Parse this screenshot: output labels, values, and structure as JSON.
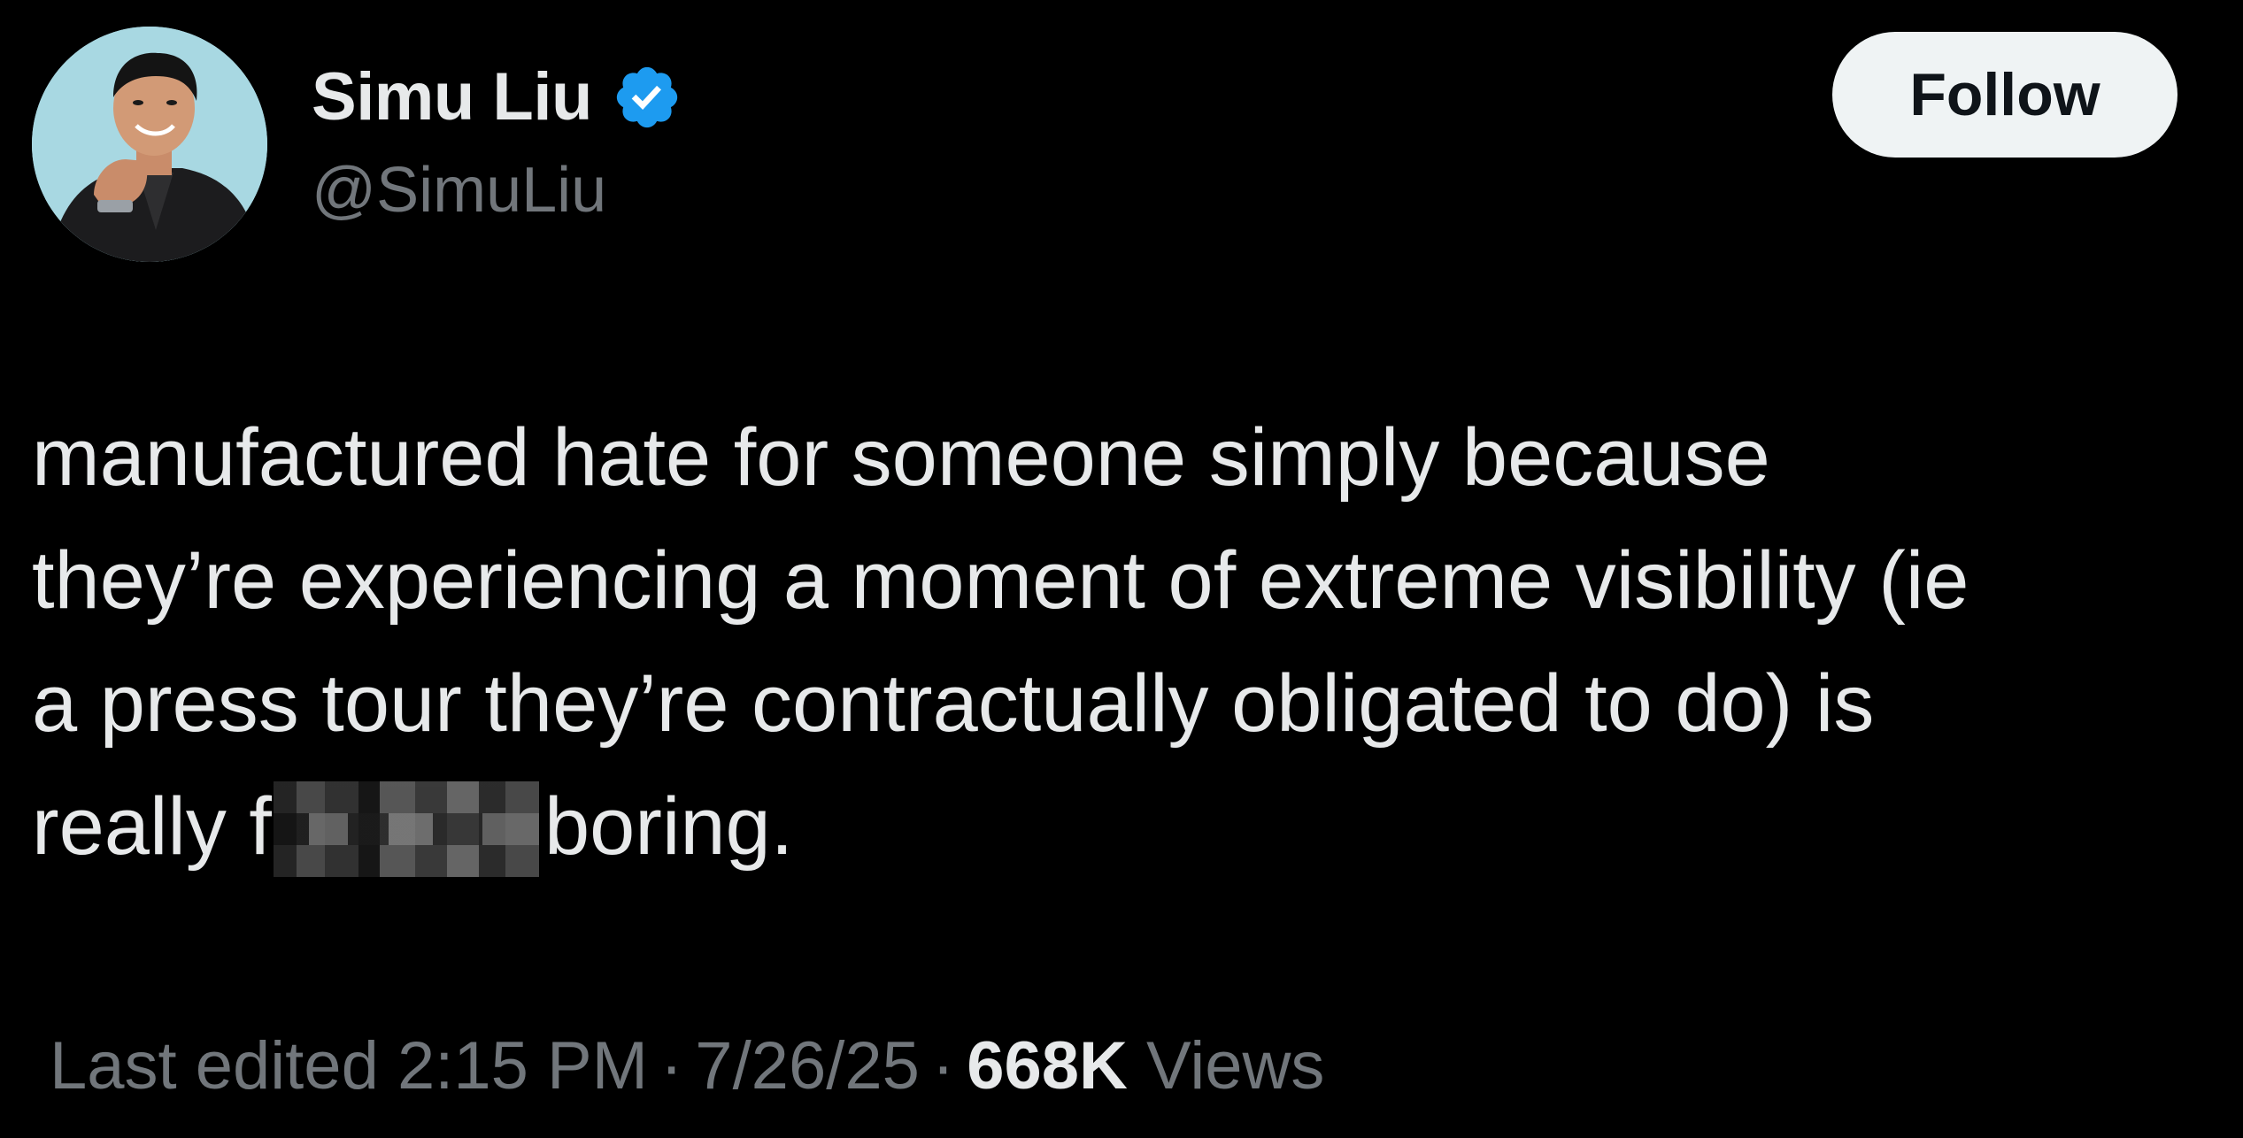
{
  "author": {
    "display_name": "Simu Liu",
    "handle": "@SimuLiu",
    "verified": true,
    "verified_badge_color": "#1d9bf0",
    "avatar_icon": "profile-photo"
  },
  "follow_button": {
    "label": "Follow"
  },
  "tweet": {
    "lines": [
      "manufactured hate for someone simply because",
      "they’re experiencing a moment of extreme visibility (ie",
      "a press tour they’re contractually obligated to do) is"
    ],
    "last_line_before": "really f",
    "last_line_after": "boring."
  },
  "meta": {
    "edited_label": "Last edited 2:15 PM",
    "separator": "·",
    "date": "7/26/25",
    "views_count": "668K",
    "views_label": "Views"
  },
  "colors": {
    "background": "#000000",
    "primary_text": "#e7e9ea",
    "secondary_text": "#71767b",
    "follow_bg": "#eff3f4"
  }
}
